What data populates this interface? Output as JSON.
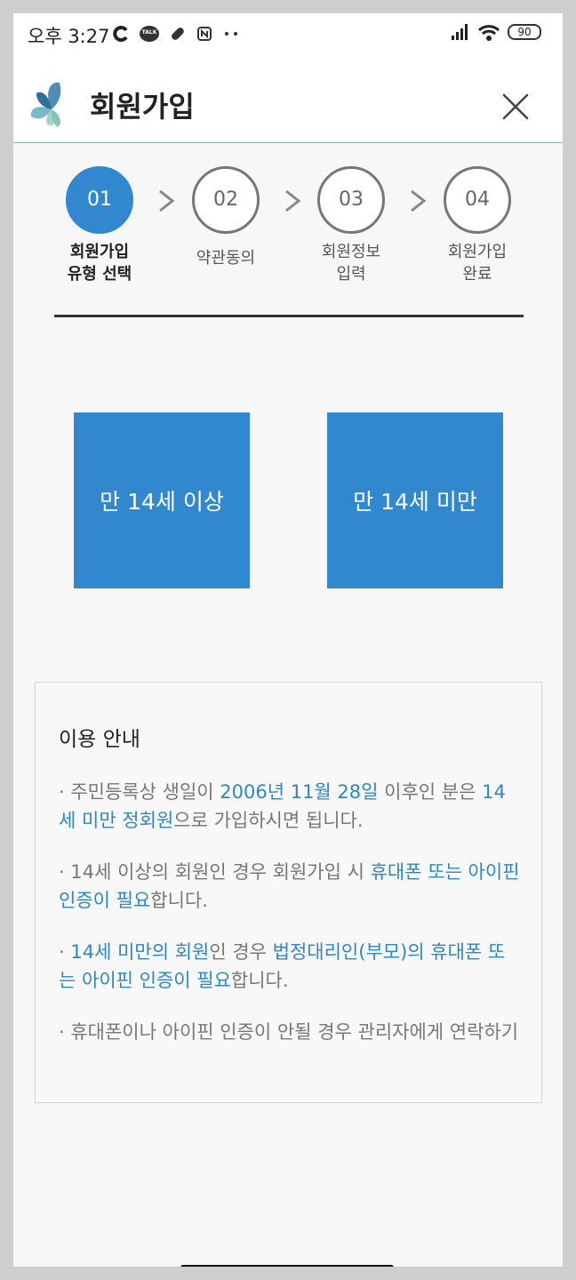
{
  "status": {
    "time": "오후 3:27",
    "talk_badge": "TALK",
    "battery": "90"
  },
  "header": {
    "title": "회원가입"
  },
  "steps": [
    {
      "num": "01",
      "label": "회원가입\n유형 선택"
    },
    {
      "num": "02",
      "label": "약관동의"
    },
    {
      "num": "03",
      "label": "회원정보\n입력"
    },
    {
      "num": "04",
      "label": "회원가입\n완료"
    }
  ],
  "choices": {
    "over14": "만 14세 이상",
    "under14": "만 14세 미만"
  },
  "info": {
    "title": "이용 안내",
    "items": [
      [
        {
          "t": "· 주민등록상 생일이 "
        },
        {
          "t": "2006년 11월 28일",
          "h": true
        },
        {
          "t": " 이후인 분은 "
        },
        {
          "t": "14세 미만 정회원",
          "h": true
        },
        {
          "t": "으로 가입하시면 됩니다."
        }
      ],
      [
        {
          "t": "· 14세 이상의 회원인 경우 회원가입 시 "
        },
        {
          "t": "휴대폰 또는 아이핀 인증이 필요",
          "h": true
        },
        {
          "t": "합니다."
        }
      ],
      [
        {
          "t": "· 14세 미만의 회원",
          "h": true
        },
        {
          "t": "인 경우 "
        },
        {
          "t": "법정대리인(부모)의 휴대폰 또는 아이핀 인증이 필요",
          "h": true
        },
        {
          "t": "합니다."
        }
      ],
      [
        {
          "t": "· 휴대폰이나 아이핀 인증이 안될 경우 관리자에게 연락하기"
        }
      ]
    ]
  },
  "colors": {
    "accent": "#3188cf",
    "highlight": "#2f86c6"
  }
}
